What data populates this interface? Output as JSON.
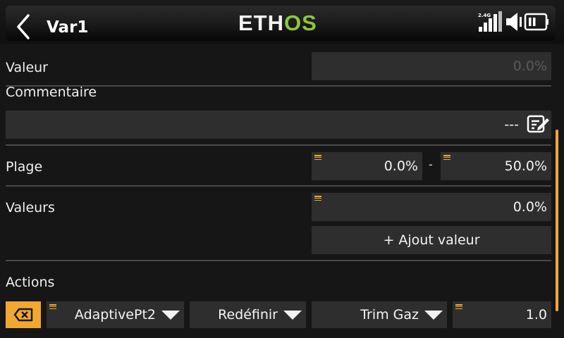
{
  "header": {
    "title": "Var1",
    "logo_white": "ETH",
    "logo_green": "OS",
    "signal_band": "2.4G",
    "logo_accent": "#8cc63f"
  },
  "valeur": {
    "label": "Valeur",
    "value": "0.0%"
  },
  "commentaire": {
    "label": "Commentaire",
    "value": "---",
    "edit_icon": "edit-icon"
  },
  "plage": {
    "label": "Plage",
    "min": "0.0%",
    "separator": "-",
    "max": "50.0%"
  },
  "valeurs": {
    "label": "Valeurs",
    "value": "0.0%",
    "add_button": "+ Ajout valeur"
  },
  "actions": {
    "label": "Actions",
    "source": "AdaptivePt2",
    "operation": "Redéfinir",
    "target": "Trim Gaz",
    "amount": "1.0",
    "accent": "#f0a830"
  }
}
